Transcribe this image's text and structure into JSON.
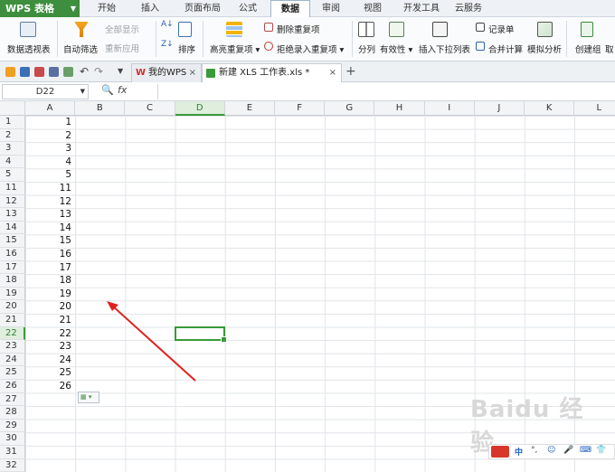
{
  "app": {
    "title": "WPS 表格"
  },
  "menu": {
    "tabs": [
      "开始",
      "插入",
      "页面布局",
      "公式",
      "数据",
      "审阅",
      "视图",
      "开发工具",
      "云服务"
    ],
    "active": "数据"
  },
  "ribbon": {
    "pivot": "数据透视表",
    "autofilter": "自动筛选",
    "show_all": "全部显示",
    "reapply": "重新应用",
    "sort": "排序",
    "highlight_dup": "高亮重复项",
    "remove_dup": "删除重复项",
    "reject_dup": "拒绝录入重复项",
    "split": "分列",
    "validity": "有效性",
    "insert_dropdown": "插入下拉列表",
    "record": "记录单",
    "consolidate": "合并计算",
    "whatif": "模拟分析",
    "create_group": "创建组",
    "ungroup": "取"
  },
  "tabs": {
    "home": "我的WPS",
    "doc": "新建 XLS 工作表.xls *",
    "close": "×",
    "add": "+"
  },
  "formula": {
    "cell_ref": "D22",
    "fx": "fx"
  },
  "grid": {
    "columns": [
      "A",
      "B",
      "C",
      "D",
      "E",
      "F",
      "G",
      "H",
      "I",
      "J",
      "K",
      "L"
    ],
    "rows": [
      "1",
      "2",
      "3",
      "4",
      "5",
      "11",
      "12",
      "13",
      "14",
      "15",
      "16",
      "17",
      "18",
      "19",
      "20",
      "21",
      "22",
      "23",
      "24",
      "25",
      "26",
      "27",
      "28",
      "29",
      "30",
      "31",
      "32"
    ],
    "values": [
      "1",
      "2",
      "3",
      "4",
      "5",
      "11",
      "12",
      "13",
      "14",
      "15",
      "16",
      "17",
      "18",
      "19",
      "20",
      "21",
      "22",
      "23",
      "24",
      "25",
      "26"
    ],
    "active_col": "D",
    "active_row": "22"
  },
  "overlay": {
    "watermark": "Baidu 经验",
    "ime": [
      "中",
      "°,",
      "☺",
      "🎤",
      "⌨",
      "👕"
    ]
  },
  "colors": {
    "accent": "#3a9a3a",
    "arrow": "#e02020"
  }
}
